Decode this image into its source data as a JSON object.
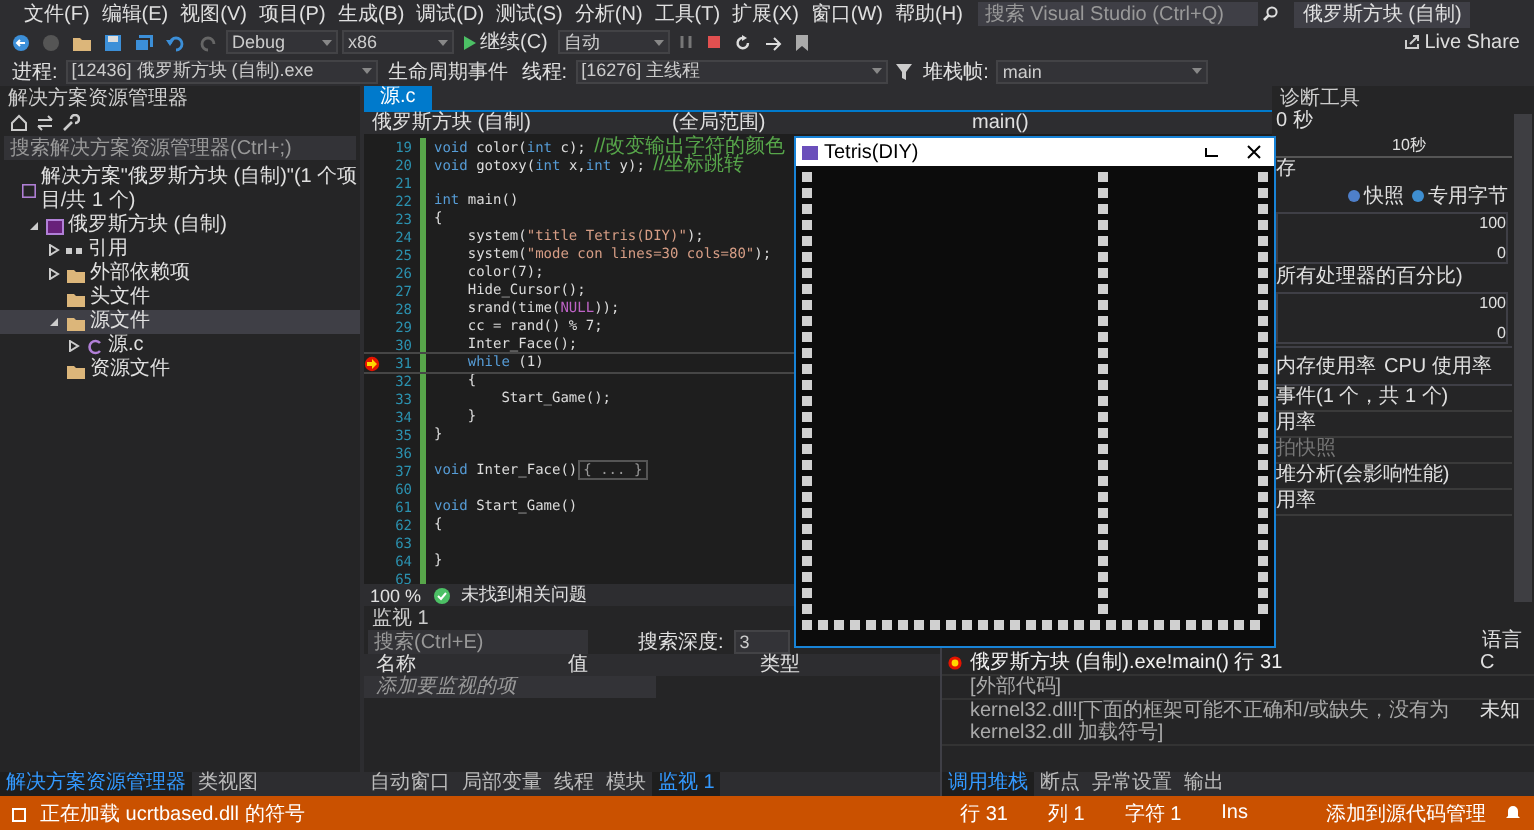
{
  "menu_bar": {
    "items": [
      "文件(F)",
      "编辑(E)",
      "视图(V)",
      "项目(P)",
      "生成(B)",
      "调试(D)",
      "测试(S)",
      "分析(N)",
      "工具(T)",
      "扩展(X)",
      "窗口(W)",
      "帮助(H)"
    ],
    "search": {
      "placeholder": "搜索 Visual Studio (Ctrl+Q)"
    },
    "title": "俄罗斯方块 (自制)"
  },
  "toolbar": {
    "configuration": "Debug",
    "platform": "x86",
    "continue_button": "继续(C)",
    "target": "自动",
    "live_share": "Live Share"
  },
  "debug_location": {
    "process_label": "进程:",
    "process": "[12436] 俄罗斯方块 (自制).exe",
    "lifecycle_events": "生命周期事件",
    "thread_label": "线程:",
    "thread": "[16276] 主线程",
    "stack_frame_label": "堆栈帧:",
    "stack_frame": "main"
  },
  "solution_explorer": {
    "title": "解决方案资源管理器",
    "search": {
      "placeholder": "搜索解决方案资源管理器(Ctrl+;)"
    },
    "tree": [
      {
        "label": "解决方案\"俄罗斯方块 (自制)\"(1 个项目/共 1 个)",
        "kind": "solution",
        "selected": false,
        "children": [
          {
            "label": "俄罗斯方块 (自制)",
            "kind": "project",
            "expanded": true,
            "selected": false,
            "children": [
              {
                "label": "引用",
                "kind": "references",
                "expanded": false,
                "selected": false
              },
              {
                "label": "外部依赖项",
                "kind": "folder",
                "expanded": false,
                "selected": false
              },
              {
                "label": "头文件",
                "kind": "folder",
                "selected": false
              },
              {
                "label": "源文件",
                "kind": "folder",
                "expanded": true,
                "selected": true,
                "children": [
                  {
                    "label": "源.c",
                    "kind": "file",
                    "expanded": false,
                    "selected": false
                  }
                ]
              },
              {
                "label": "资源文件",
                "kind": "folder",
                "selected": false
              }
            ]
          }
        ]
      }
    ],
    "tabs": [
      {
        "label": "解决方案资源管理器",
        "selected": true
      },
      {
        "label": "类视图",
        "selected": false
      }
    ]
  },
  "editor": {
    "tabs": [
      {
        "label": "源.c",
        "selected": true
      }
    ],
    "nav": {
      "project": "俄罗斯方块 (自制)",
      "scope": "(全局范围)",
      "function": "main()"
    },
    "lines": [
      {
        "no": "19",
        "tokens": [
          {
            "t": "void",
            "kind": "kw"
          },
          {
            "t": " color(",
            "kind": "plain"
          },
          {
            "t": "int",
            "kind": "kw"
          },
          {
            "t": " c); ",
            "kind": "plain"
          },
          {
            "t": "//改变输出字符的颜色",
            "kind": "comment"
          }
        ]
      },
      {
        "no": "20",
        "tokens": [
          {
            "t": "void",
            "kind": "kw"
          },
          {
            "t": " gotoxy(",
            "kind": "plain"
          },
          {
            "t": "int",
            "kind": "kw"
          },
          {
            "t": " x,",
            "kind": "plain"
          },
          {
            "t": "int",
            "kind": "kw"
          },
          {
            "t": " y); ",
            "kind": "plain"
          },
          {
            "t": "//坐标跳转",
            "kind": "comment"
          }
        ]
      },
      {
        "no": "21"
      },
      {
        "no": "22",
        "tokens": [
          {
            "t": "int",
            "kind": "kw"
          },
          {
            "t": " main()",
            "kind": "plain"
          }
        ]
      },
      {
        "no": "23",
        "tokens": [
          {
            "t": "{",
            "kind": "plain"
          }
        ]
      },
      {
        "no": "24",
        "tokens": [
          {
            "t": "    system(",
            "kind": "plain"
          },
          {
            "t": "\"title Tetris(DIY)\"",
            "kind": "string"
          },
          {
            "t": ");",
            "kind": "plain"
          }
        ]
      },
      {
        "no": "25",
        "tokens": [
          {
            "t": "    system(",
            "kind": "plain"
          },
          {
            "t": "\"mode con lines=30 cols=80\"",
            "kind": "string"
          },
          {
            "t": ");",
            "kind": "plain"
          }
        ]
      },
      {
        "no": "26",
        "tokens": [
          {
            "t": "    color(7);",
            "kind": "plain"
          }
        ]
      },
      {
        "no": "27",
        "tokens": [
          {
            "t": "    Hide_Cursor();",
            "kind": "plain"
          }
        ]
      },
      {
        "no": "28",
        "tokens": [
          {
            "t": "    srand(time(",
            "kind": "plain"
          },
          {
            "t": "NULL",
            "kind": "macro"
          },
          {
            "t": "));",
            "kind": "plain"
          }
        ]
      },
      {
        "no": "29",
        "tokens": [
          {
            "t": "    cc = rand() % 7;",
            "kind": "plain"
          }
        ]
      },
      {
        "no": "30",
        "tokens": [
          {
            "t": "    Inter_Face();",
            "kind": "plain"
          }
        ]
      },
      {
        "no": "31",
        "current": true,
        "tokens": [
          {
            "t": "    while",
            "kind": "kw"
          },
          {
            "t": " (1)",
            "kind": "plain"
          }
        ]
      },
      {
        "no": "32",
        "tokens": [
          {
            "t": "    {",
            "kind": "plain"
          }
        ]
      },
      {
        "no": "33",
        "tokens": [
          {
            "t": "        Start_Game();",
            "kind": "plain"
          }
        ]
      },
      {
        "no": "34",
        "tokens": [
          {
            "t": "    }",
            "kind": "plain"
          }
        ]
      },
      {
        "no": "35",
        "tokens": [
          {
            "t": "}",
            "kind": "plain"
          }
        ]
      },
      {
        "no": "36"
      },
      {
        "no": "37",
        "tokens": [
          {
            "t": "void",
            "kind": "kw"
          },
          {
            "t": " Inter_Face()",
            "kind": "plain"
          },
          {
            "t": "{ ... }",
            "kind": "fold"
          }
        ]
      },
      {
        "no": "60"
      },
      {
        "no": "61",
        "tokens": [
          {
            "t": "void",
            "kind": "kw"
          },
          {
            "t": " Start_Game()",
            "kind": "plain"
          }
        ]
      },
      {
        "no": "62",
        "tokens": [
          {
            "t": "{",
            "kind": "plain"
          }
        ]
      },
      {
        "no": "63"
      },
      {
        "no": "64",
        "tokens": [
          {
            "t": "}",
            "kind": "plain"
          }
        ]
      },
      {
        "no": "65"
      }
    ],
    "zoom": "100 %",
    "issues": "未找到相关问题"
  },
  "console": {
    "title": "Tetris(DIY)"
  },
  "diagnostics": {
    "title": "诊断工具",
    "session": "0 秒",
    "timeline_label": "10秒",
    "memory_section": "存",
    "legend": [
      {
        "label": "快照",
        "color": "#4e7fc9"
      },
      {
        "label": "专用字节",
        "color": "#3e8ed0"
      }
    ],
    "memory_axis": [
      "100",
      "0"
    ],
    "cpu_section": "所有处理器的百分比)",
    "cpu_axis": [
      "100",
      "0"
    ],
    "tabs": [
      {
        "label": "内存使用率",
        "selected": false
      },
      {
        "label": "CPU 使用率",
        "selected": false
      }
    ],
    "rows": [
      {
        "label": "事件(1 个，共 1 个)",
        "disabled": false
      },
      {
        "label": "用率",
        "disabled": false
      },
      {
        "label": "拍快照",
        "disabled": true
      },
      {
        "label": "堆分析(会影响性能)",
        "disabled": false
      },
      {
        "label": "用率",
        "disabled": false
      }
    ]
  },
  "watch": {
    "title": "监视 1",
    "search": {
      "placeholder": "搜索(Ctrl+E)"
    },
    "depth_label": "搜索深度:",
    "depth": "3",
    "columns": [
      "名称",
      "值",
      "类型"
    ],
    "placeholder_row": "添加要监视的项",
    "tabs": [
      {
        "label": "自动窗口",
        "selected": false
      },
      {
        "label": "局部变量",
        "selected": false
      },
      {
        "label": "线程",
        "selected": false
      },
      {
        "label": "模块",
        "selected": false
      },
      {
        "label": "监视 1",
        "selected": true
      }
    ]
  },
  "call_stack": {
    "language_column": "语言",
    "rows": [
      {
        "name": "俄罗斯方块 (自制).exe!main() 行 31",
        "language": "C",
        "current": true
      },
      {
        "name": "[外部代码]",
        "current": false
      },
      {
        "name": "kernel32.dll![下面的框架可能不正确和/或缺失，没有为 kernel32.dll 加载符号]",
        "language": "未知",
        "current": false
      }
    ],
    "tabs": [
      {
        "label": "调用堆栈",
        "selected": true
      },
      {
        "label": "断点",
        "selected": false
      },
      {
        "label": "异常设置",
        "selected": false
      },
      {
        "label": "输出",
        "selected": false
      }
    ]
  },
  "status_bar": {
    "message": "正在加载 ucrtbased.dll 的符号",
    "line": "行 31",
    "column": "列 1",
    "char": "字符 1",
    "mode": "Ins",
    "source_control": "添加到源代码管理"
  }
}
